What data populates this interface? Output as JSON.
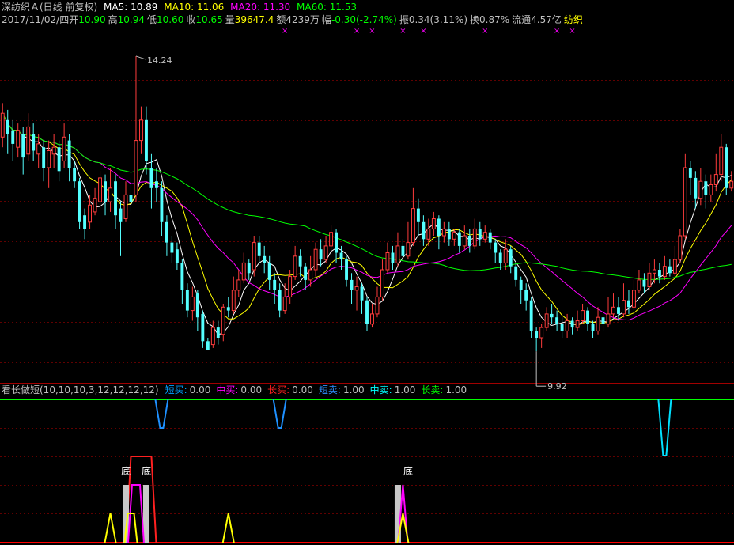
{
  "header": {
    "stock_name": "深纺织Ａ(日线 前复权)",
    "ma": [
      {
        "label": "MA5: 10.89",
        "color": "#ffffff"
      },
      {
        "label": "MA10: 11.06",
        "color": "#ffff00"
      },
      {
        "label": "MA20: 11.30",
        "color": "#ff00ff"
      },
      {
        "label": "MA60: 11.53",
        "color": "#00ff00"
      }
    ],
    "date": "2017/11/02/四",
    "quote": [
      {
        "label": "开",
        "value": "10.90",
        "color": "#00ff00"
      },
      {
        "label": "高",
        "value": "10.94",
        "color": "#00ff00"
      },
      {
        "label": "低",
        "value": "10.60",
        "color": "#00ff00"
      },
      {
        "label": "收",
        "value": "10.65",
        "color": "#00ff00"
      },
      {
        "label": "量",
        "value": "39647.4",
        "color": "#ffff00"
      },
      {
        "label": "额",
        "value": "4239万",
        "color": "#c0c0c0"
      },
      {
        "label": "幅",
        "value": "-0.30(-2.74%)",
        "color": "#00ff00"
      },
      {
        "label": "振",
        "value": "0.34(3.11%)",
        "color": "#c0c0c0"
      },
      {
        "label": "换",
        "value": "0.87%",
        "color": "#c0c0c0"
      },
      {
        "label": "流通",
        "value": "4.57亿",
        "color": "#c0c0c0"
      },
      {
        "label": "",
        "value": "纺织",
        "color": "#ffff00"
      }
    ]
  },
  "indicator": {
    "name": "看长做短(10,10,10,3,12,12,12,12)",
    "values": [
      {
        "label": "短买:",
        "value": "0.00",
        "color": "#00a0ff"
      },
      {
        "label": "中买:",
        "value": "0.00",
        "color": "#ff00ff"
      },
      {
        "label": "长买:",
        "value": "0.00",
        "color": "#ff2020"
      },
      {
        "label": "短卖:",
        "value": "1.00",
        "color": "#3090ff"
      },
      {
        "label": "中卖:",
        "value": "1.00",
        "color": "#00ffff"
      },
      {
        "label": "长卖:",
        "value": "1.00",
        "color": "#00ff00"
      }
    ],
    "bottom_label": "底"
  },
  "chart_data": {
    "type": "candlestick",
    "high_label": "14.24",
    "low_label": "9.92",
    "ylim": [
      9.6,
      14.6
    ],
    "candles": [
      [
        13.05,
        13.4,
        13.55,
        12.9
      ],
      [
        13.3,
        13.1,
        13.45,
        12.8
      ],
      [
        13.15,
        12.95,
        13.3,
        12.7
      ],
      [
        12.9,
        13.15,
        13.25,
        12.75
      ],
      [
        13.1,
        12.75,
        13.2,
        12.5
      ],
      [
        12.8,
        13.2,
        13.4,
        12.7
      ],
      [
        13.1,
        12.85,
        13.25,
        12.7
      ],
      [
        12.8,
        12.95,
        13.1,
        12.6
      ],
      [
        12.9,
        12.6,
        13.0,
        12.4
      ],
      [
        12.6,
        12.85,
        13.0,
        12.3
      ],
      [
        12.8,
        12.9,
        13.1,
        12.6
      ],
      [
        12.9,
        12.55,
        13.0,
        12.4
      ],
      [
        12.7,
        13.05,
        13.25,
        12.6
      ],
      [
        13.0,
        12.6,
        13.1,
        12.4
      ],
      [
        12.6,
        12.4,
        12.7,
        12.3
      ],
      [
        12.4,
        11.8,
        12.45,
        11.7
      ],
      [
        11.9,
        11.7,
        12.0,
        11.55
      ],
      [
        11.8,
        12.05,
        12.2,
        11.7
      ],
      [
        11.95,
        12.15,
        12.3,
        11.9
      ],
      [
        12.1,
        12.45,
        12.55,
        12.0
      ],
      [
        12.4,
        12.1,
        12.5,
        11.9
      ],
      [
        12.1,
        12.3,
        12.6,
        11.95
      ],
      [
        12.4,
        11.9,
        12.5,
        11.7
      ],
      [
        12.0,
        11.8,
        12.1,
        11.3
      ],
      [
        11.85,
        12.2,
        12.4,
        11.8
      ],
      [
        12.2,
        12.1,
        12.45,
        11.95
      ],
      [
        12.2,
        13.0,
        14.24,
        12.1
      ],
      [
        13.0,
        13.3,
        13.5,
        12.8
      ],
      [
        13.3,
        12.7,
        13.5,
        12.5
      ],
      [
        12.6,
        12.3,
        12.8,
        12.0
      ],
      [
        12.4,
        12.3,
        12.6,
        12.1
      ],
      [
        12.3,
        11.8,
        12.4,
        11.6
      ],
      [
        11.8,
        11.5,
        11.9,
        11.3
      ],
      [
        11.5,
        11.35,
        11.6,
        11.2
      ],
      [
        11.4,
        11.2,
        11.5,
        11.1
      ],
      [
        11.2,
        10.8,
        11.25,
        10.6
      ],
      [
        10.8,
        10.5,
        10.9,
        10.4
      ],
      [
        10.5,
        10.7,
        10.85,
        10.35
      ],
      [
        10.75,
        10.4,
        10.8,
        10.2
      ],
      [
        10.45,
        10.05,
        10.5,
        9.95
      ],
      [
        10.05,
        9.92,
        10.1,
        9.92
      ],
      [
        10.0,
        10.25,
        10.35,
        9.95
      ],
      [
        10.25,
        10.1,
        10.35,
        10.0
      ],
      [
        10.15,
        10.55,
        10.6,
        10.05
      ],
      [
        10.55,
        10.5,
        10.7,
        10.4
      ],
      [
        10.5,
        10.8,
        11.0,
        10.45
      ],
      [
        10.8,
        10.95,
        11.1,
        10.7
      ],
      [
        10.95,
        11.2,
        11.35,
        10.9
      ],
      [
        11.2,
        11.05,
        11.25,
        10.95
      ],
      [
        11.1,
        11.5,
        11.6,
        11.0
      ],
      [
        11.5,
        11.3,
        11.6,
        11.2
      ],
      [
        11.3,
        11.2,
        11.45,
        11.05
      ],
      [
        11.2,
        10.95,
        11.3,
        10.8
      ],
      [
        10.95,
        10.8,
        11.05,
        10.6
      ],
      [
        10.8,
        10.5,
        10.9,
        10.4
      ],
      [
        10.5,
        10.7,
        10.9,
        10.45
      ],
      [
        10.7,
        11.0,
        11.1,
        10.6
      ],
      [
        11.0,
        11.3,
        11.45,
        10.95
      ],
      [
        11.3,
        11.15,
        11.4,
        11.0
      ],
      [
        11.15,
        10.95,
        11.2,
        10.8
      ],
      [
        10.95,
        11.1,
        11.3,
        10.85
      ],
      [
        11.1,
        11.4,
        11.5,
        11.0
      ],
      [
        11.4,
        11.25,
        11.55,
        11.15
      ],
      [
        11.25,
        11.45,
        11.6,
        11.2
      ],
      [
        11.45,
        11.65,
        11.75,
        11.35
      ],
      [
        11.65,
        11.35,
        11.7,
        11.2
      ],
      [
        11.35,
        11.25,
        11.45,
        11.1
      ],
      [
        11.25,
        10.95,
        11.3,
        10.85
      ],
      [
        10.95,
        10.8,
        11.05,
        10.6
      ],
      [
        10.8,
        10.85,
        11.0,
        10.5
      ],
      [
        10.85,
        10.65,
        10.9,
        10.45
      ],
      [
        10.65,
        10.3,
        10.7,
        10.2
      ],
      [
        10.3,
        10.45,
        10.6,
        10.25
      ],
      [
        10.45,
        10.7,
        10.85,
        10.4
      ],
      [
        10.7,
        11.1,
        11.25,
        10.65
      ],
      [
        11.1,
        11.35,
        11.5,
        11.05
      ],
      [
        11.35,
        11.2,
        11.45,
        11.1
      ],
      [
        11.2,
        11.45,
        11.65,
        11.15
      ],
      [
        11.45,
        11.3,
        11.55,
        11.2
      ],
      [
        11.3,
        11.5,
        11.8,
        11.25
      ],
      [
        11.5,
        12.0,
        12.3,
        11.45
      ],
      [
        12.0,
        11.8,
        12.15,
        11.6
      ],
      [
        11.8,
        11.55,
        11.9,
        11.45
      ],
      [
        11.55,
        11.7,
        11.85,
        11.45
      ],
      [
        11.7,
        11.85,
        11.95,
        11.6
      ],
      [
        11.85,
        11.6,
        11.9,
        11.4
      ],
      [
        11.6,
        11.7,
        11.8,
        11.5
      ],
      [
        11.7,
        11.55,
        11.8,
        11.45
      ],
      [
        11.55,
        11.65,
        11.7,
        11.45
      ],
      [
        11.65,
        11.45,
        11.7,
        11.35
      ],
      [
        11.45,
        11.6,
        11.75,
        11.4
      ],
      [
        11.6,
        11.45,
        11.7,
        11.35
      ],
      [
        11.45,
        11.7,
        11.85,
        11.4
      ],
      [
        11.7,
        11.55,
        11.8,
        11.45
      ],
      [
        11.55,
        11.65,
        11.75,
        11.5
      ],
      [
        11.65,
        11.5,
        11.7,
        11.4
      ],
      [
        11.5,
        11.35,
        11.55,
        11.2
      ],
      [
        11.35,
        11.2,
        11.4,
        11.1
      ],
      [
        11.2,
        11.4,
        11.55,
        11.1
      ],
      [
        11.4,
        11.15,
        11.45,
        11.05
      ],
      [
        11.15,
        10.95,
        11.2,
        10.85
      ],
      [
        10.95,
        10.8,
        11.0,
        10.6
      ],
      [
        10.8,
        10.65,
        10.9,
        10.5
      ],
      [
        10.65,
        10.2,
        10.7,
        10.1
      ],
      [
        10.2,
        10.1,
        10.25,
        9.9
      ],
      [
        10.1,
        10.25,
        10.3,
        9.95
      ],
      [
        10.25,
        10.45,
        10.55,
        10.2
      ],
      [
        10.45,
        10.4,
        10.6,
        10.3
      ],
      [
        10.4,
        10.3,
        10.5,
        10.2
      ],
      [
        10.3,
        10.2,
        10.4,
        10.1
      ],
      [
        10.2,
        10.35,
        10.45,
        10.1
      ],
      [
        10.35,
        10.25,
        10.4,
        10.15
      ],
      [
        10.25,
        10.35,
        10.5,
        10.2
      ],
      [
        10.35,
        10.5,
        10.6,
        10.3
      ],
      [
        10.5,
        10.3,
        10.55,
        10.2
      ],
      [
        10.3,
        10.2,
        10.35,
        10.1
      ],
      [
        10.2,
        10.4,
        10.55,
        10.15
      ],
      [
        10.4,
        10.3,
        10.45,
        10.2
      ],
      [
        10.3,
        10.45,
        10.7,
        10.25
      ],
      [
        10.45,
        10.55,
        10.75,
        10.4
      ],
      [
        10.55,
        10.45,
        10.7,
        10.35
      ],
      [
        10.45,
        10.65,
        10.9,
        10.4
      ],
      [
        10.65,
        10.55,
        10.8,
        10.45
      ],
      [
        10.55,
        10.8,
        10.95,
        10.5
      ],
      [
        10.8,
        10.95,
        11.1,
        10.75
      ],
      [
        10.95,
        10.85,
        11.05,
        10.75
      ],
      [
        10.85,
        11.05,
        11.2,
        10.8
      ],
      [
        11.05,
        11.1,
        11.25,
        10.9
      ],
      [
        11.1,
        11.0,
        11.2,
        10.9
      ],
      [
        11.0,
        11.15,
        11.3,
        10.95
      ],
      [
        11.15,
        11.05,
        11.25,
        11.0
      ],
      [
        11.05,
        11.25,
        11.45,
        11.0
      ],
      [
        11.25,
        11.6,
        11.7,
        11.2
      ],
      [
        11.6,
        12.6,
        12.8,
        11.55
      ],
      [
        12.6,
        12.45,
        12.7,
        12.2
      ],
      [
        12.45,
        12.15,
        12.55,
        12.0
      ],
      [
        12.15,
        12.4,
        12.6,
        12.05
      ],
      [
        12.4,
        12.2,
        12.5,
        12.0
      ],
      [
        12.2,
        12.35,
        12.5,
        12.1
      ],
      [
        12.35,
        12.5,
        12.8,
        12.25
      ],
      [
        12.5,
        12.9,
        13.1,
        12.4
      ],
      [
        12.9,
        12.3,
        12.95,
        12.2
      ],
      [
        12.3,
        12.4,
        12.55,
        12.25
      ]
    ],
    "sell_signals": [
      31,
      54,
      129
    ],
    "buy_bars": [
      24,
      28,
      77
    ],
    "bottom_labels": [
      24,
      28,
      79
    ],
    "yellow_peaks": [
      21,
      25,
      44,
      78
    ],
    "magenta_peaks": [
      26,
      78
    ],
    "red_box": [
      25,
      29
    ],
    "markers": [
      55,
      69,
      72,
      78,
      82,
      94,
      108,
      111
    ]
  }
}
